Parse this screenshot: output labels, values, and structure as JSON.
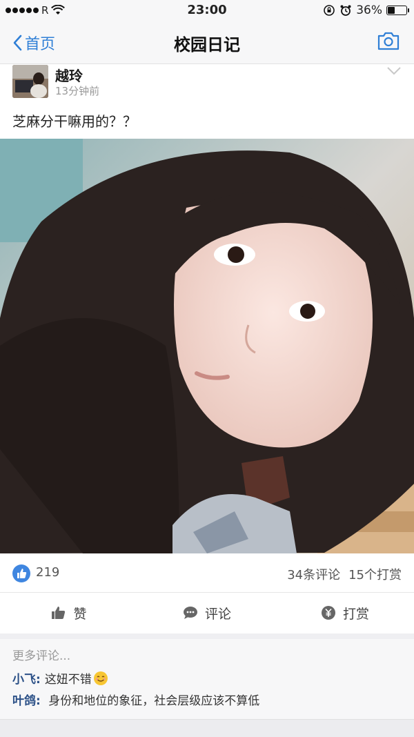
{
  "status_bar": {
    "carrier": "R",
    "time": "23:00",
    "battery_percent": "36%",
    "battery_level": 0.36
  },
  "nav": {
    "back_label": "首页",
    "title": "校园日记"
  },
  "post": {
    "author": "越玲",
    "time": "13分钟前",
    "text": "芝麻分干嘛用的？？",
    "likes": "219",
    "comments_count": "34条评论",
    "tips_count": "15个打赏"
  },
  "actions": {
    "like": "赞",
    "comment": "评论",
    "tip": "打赏"
  },
  "comments": {
    "more": "更多评论...",
    "items": [
      {
        "name": "小飞:",
        "text": "这妞不错"
      },
      {
        "name": "叶鸽:",
        "text": "身份和地位的象征，社会层级应该不算低"
      }
    ]
  },
  "colors": {
    "accent": "#2f7fd6",
    "like_badge": "#3f86e0",
    "comment_name": "#2a4f86"
  }
}
